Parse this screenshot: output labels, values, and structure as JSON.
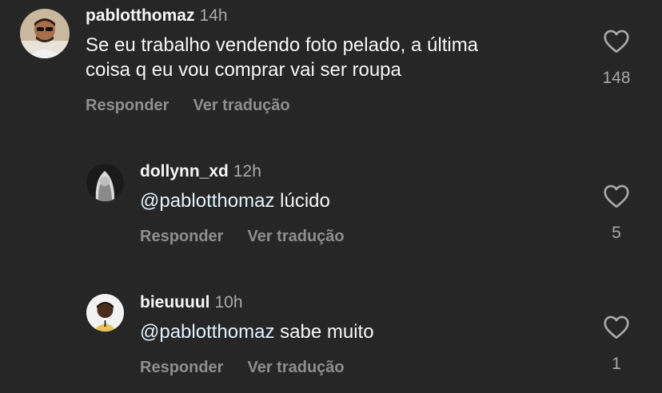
{
  "comments": [
    {
      "username": "pablotthomaz",
      "time": "14h",
      "text_line1": "Se eu trabalho vendendo foto pelado, a última",
      "text_line2": "coisa q eu vou comprar vai ser roupa",
      "likes": "148",
      "reply_label": "Responder",
      "translate_label": "Ver tradução"
    },
    {
      "username": "dollynn_xd",
      "time": "12h",
      "mention": "@pablotthomaz",
      "text": "lúcido",
      "likes": "5",
      "reply_label": "Responder",
      "translate_label": "Ver tradução"
    },
    {
      "username": "bieuuuul",
      "time": "10h",
      "mention": "@pablotthomaz",
      "text": "sabe muito",
      "likes": "1",
      "reply_label": "Responder",
      "translate_label": "Ver tradução"
    }
  ],
  "colors": {
    "background": "#262626",
    "primary_text": "#f5f5f5",
    "secondary_text": "#8e8e8e",
    "mention": "#e0f1ff"
  },
  "icons": {
    "like": "heart-outline-icon"
  }
}
